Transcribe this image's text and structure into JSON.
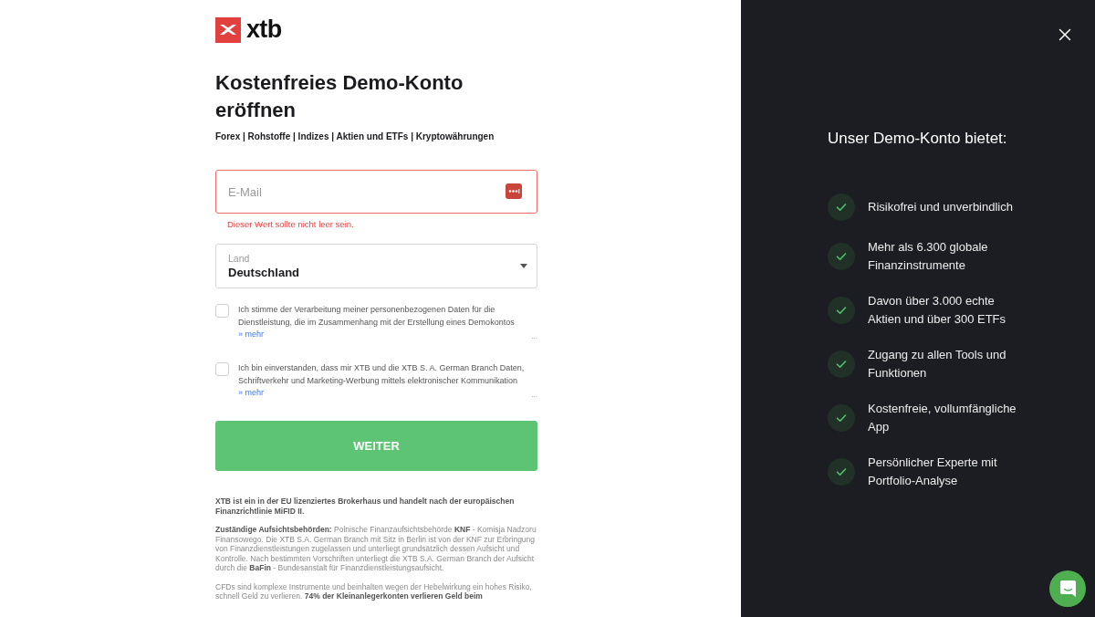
{
  "logo": {
    "text": "xtb"
  },
  "title": "Kostenfreies Demo-Konto eröffnen",
  "subtitle": "Forex | Rohstoffe | Indizes | Aktien und ETFs | Kryptowährungen",
  "email": {
    "placeholder": "E-Mail",
    "invalid": true,
    "error": "Dieser Wert sollte nicht leer sein."
  },
  "country": {
    "label": "Land",
    "value": "Deutschland"
  },
  "consents": [
    {
      "text": "Ich stimme der Verarbeitung meiner personenbezogenen Daten für die Dienstleistung, die im Zusammenhang mit der Erstellung eines Demokontos",
      "more": "» mehr",
      "ellipsis": "...",
      "checked": false
    },
    {
      "text": "Ich bin einverstanden, dass mir XTB und die XTB S. A. German Branch Daten, Schriftverkehr und Marketing-Werbung mittels elektronischer Kommunikation",
      "more": "» mehr",
      "ellipsis": "...",
      "checked": false
    }
  ],
  "submit_button": "WEITER",
  "disclaimer": [
    {
      "text": "XTB ist ein in der EU lizenziertes Brokerhaus und handelt nach der europäischen Finanzrichtlinie MiFID II.",
      "bold": true
    },
    {
      "text": "**Zuständige Aufsichtsbehörden:** Polnische Finanzaufsichtsbehörde **KNF** - Komisja Nadzoru Finansowego. Die XTB S.A. German Branch mit Sitz in Berlin ist von der KNF zur Erbringung von Finanzdienstleistungen zugelassen und unterliegt grundsätzlich dessen Aufsicht und Kontrolle. Nach bestimmten Vorschriften unterliegt die XTB S.A. German Branch der Aufsicht durch die **BaFin** - Bundesanstalt für Finanzdienstleistungsaufsicht.",
      "bold": false
    },
    {
      "text": "CFDs sind komplexe Instrumente und beinhalten wegen der Hebelwirkung ein hohes Risiko, schnell Geld zu verlieren. **74% der Kleinanlegerkonten verlieren Geld beim**",
      "bold": false
    }
  ],
  "benefits_panel": {
    "heading": "Unser Demo-Konto bietet:",
    "items": [
      "Risikofrei und unverbindlich",
      "Mehr als 6.300 globale Finanzinstrumente",
      "Davon über 3.000 echte Aktien und über 300 ETFs",
      "Zugang zu allen Tools und Funktionen",
      "Kostenfreie, vollumfängliche App",
      "Persönlicher Experte mit Portfolio-Analyse"
    ]
  }
}
